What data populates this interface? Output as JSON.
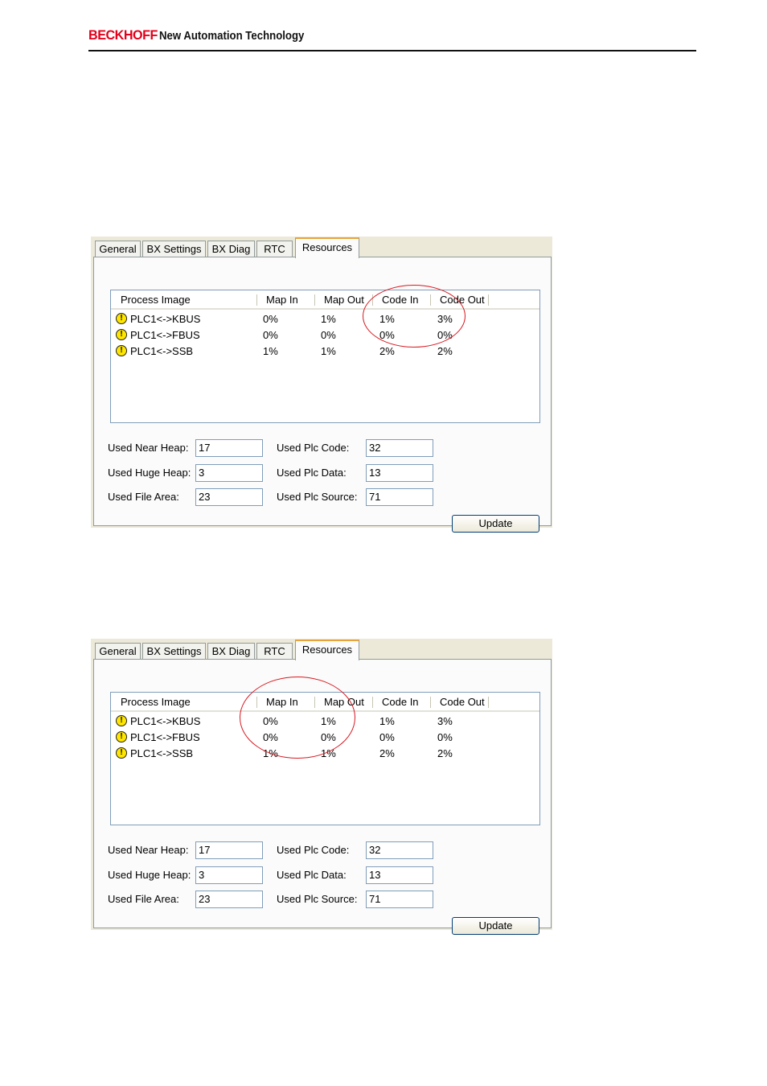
{
  "header": {
    "brand": "BECKHOFF",
    "tagline": "New Automation Technology"
  },
  "dialogs": [
    {
      "tabs": [
        "General",
        "BX Settings",
        "BX Diag",
        "RTC",
        "Resources"
      ],
      "columns": [
        "Process Image",
        "Map In",
        "Map Out",
        "Code In",
        "Code Out"
      ],
      "rows": [
        {
          "name": "PLC1<->KBUS",
          "map_in": "0%",
          "map_out": "1%",
          "code_in": "1%",
          "code_out": "3%"
        },
        {
          "name": "PLC1<->FBUS",
          "map_in": "0%",
          "map_out": "0%",
          "code_in": "0%",
          "code_out": "0%"
        },
        {
          "name": "PLC1<->SSB",
          "map_in": "1%",
          "map_out": "1%",
          "code_in": "2%",
          "code_out": "2%"
        }
      ],
      "fields": {
        "near_heap_label": "Used Near Heap:",
        "near_heap": "17",
        "huge_heap_label": "Used Huge Heap:",
        "huge_heap": "3",
        "file_area_label": "Used File Area:",
        "file_area": "23",
        "plc_code_label": "Used Plc Code:",
        "plc_code": "32",
        "plc_data_label": "Used Plc Data:",
        "plc_data": "13",
        "plc_source_label": "Used Plc Source:",
        "plc_source": "71"
      },
      "update_label": "Update",
      "highlight": "Code In / Code Out"
    },
    {
      "tabs": [
        "General",
        "BX Settings",
        "BX Diag",
        "RTC",
        "Resources"
      ],
      "columns": [
        "Process Image",
        "Map In",
        "Map Out",
        "Code In",
        "Code Out"
      ],
      "rows": [
        {
          "name": "PLC1<->KBUS",
          "map_in": "0%",
          "map_out": "1%",
          "code_in": "1%",
          "code_out": "3%"
        },
        {
          "name": "PLC1<->FBUS",
          "map_in": "0%",
          "map_out": "0%",
          "code_in": "0%",
          "code_out": "0%"
        },
        {
          "name": "PLC1<->SSB",
          "map_in": "1%",
          "map_out": "1%",
          "code_in": "2%",
          "code_out": "2%"
        }
      ],
      "fields": {
        "near_heap_label": "Used Near Heap:",
        "near_heap": "17",
        "huge_heap_label": "Used Huge Heap:",
        "huge_heap": "3",
        "file_area_label": "Used File Area:",
        "file_area": "23",
        "plc_code_label": "Used Plc Code:",
        "plc_code": "32",
        "plc_data_label": "Used Plc Data:",
        "plc_data": "13",
        "plc_source_label": "Used Plc Source:",
        "plc_source": "71"
      },
      "update_label": "Update",
      "highlight": "Map In / Map Out"
    }
  ],
  "colors": {
    "brand": "#e2001a",
    "highlight_circle": "#d71920",
    "active_tab_accent": "#e8a43a"
  }
}
